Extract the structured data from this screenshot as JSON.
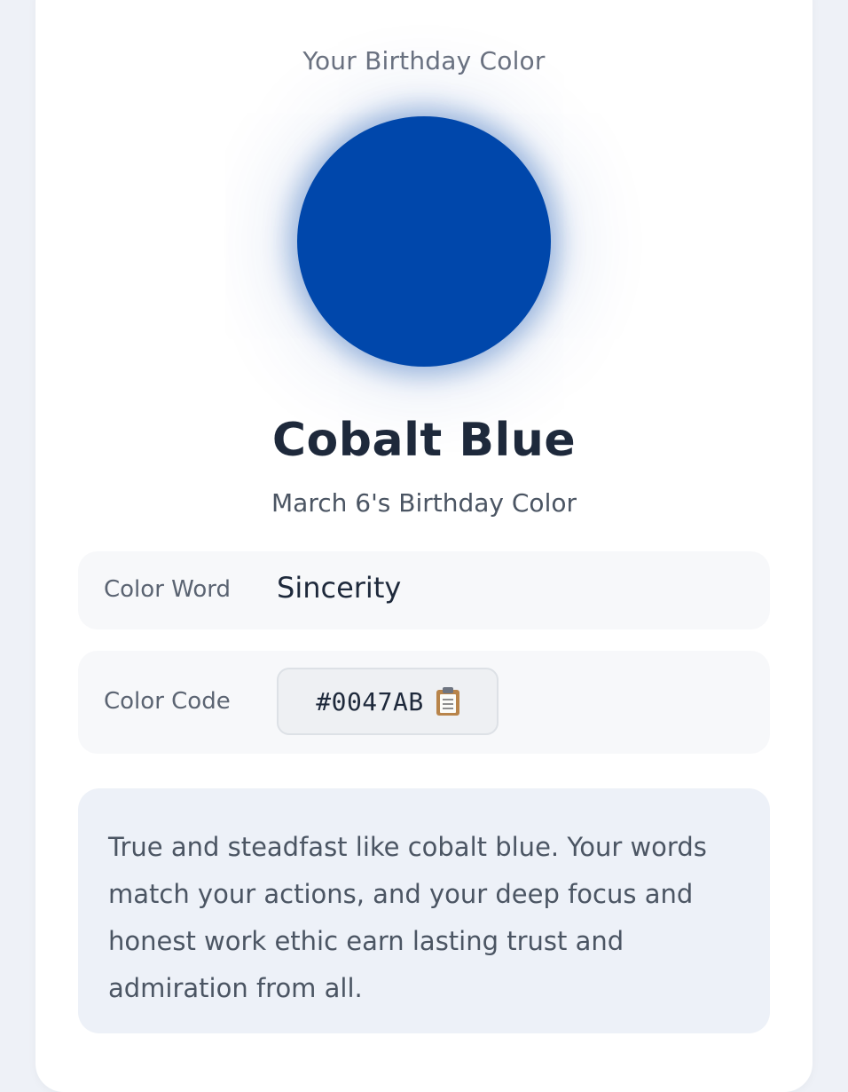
{
  "header": {
    "eyebrow": "Your Birthday Color"
  },
  "color": {
    "name": "Cobalt Blue",
    "hex": "#0047AB",
    "swatch_color": "#0047AB",
    "subtitle": "March 6's Birthday Color"
  },
  "details": {
    "word_label": "Color Word",
    "word_value": "Sincerity",
    "code_label": "Color Code",
    "code_value": "#0047AB",
    "copy_icon": "clipboard-icon"
  },
  "description": {
    "text": "True and steadfast like cobalt blue. Your words match your actions, and your deep focus and honest work ethic earn lasting trust and admiration from all."
  },
  "colors": {
    "page_background": "#eef1f7",
    "card_background": "#ffffff",
    "text_primary": "#1e293b",
    "text_secondary": "#6b7280",
    "description_background": "#edf1f8"
  }
}
